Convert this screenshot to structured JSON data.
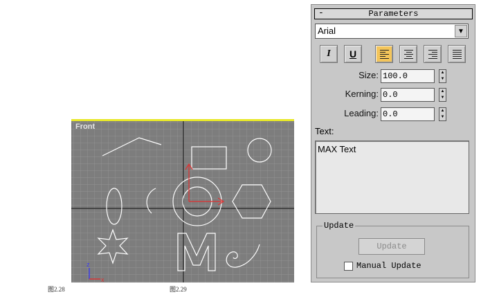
{
  "viewport": {
    "label": "Front",
    "axis_x": "x",
    "axis_z": "z"
  },
  "captions": {
    "left": "图2.28",
    "right": "图2.29"
  },
  "panel": {
    "header_symbol": "-",
    "title": "Parameters",
    "font": {
      "value": "Arial",
      "arrow": "▼"
    },
    "style_buttons": {
      "italic": "I",
      "underline": "U"
    },
    "size": {
      "label": "Size:",
      "value": "100.0"
    },
    "kerning": {
      "label": "Kerning:",
      "value": "0.0"
    },
    "leading": {
      "label": "Leading:",
      "value": "0.0"
    },
    "spinner_up": "▲",
    "spinner_down": "▼",
    "text": {
      "label": "Text:",
      "value": "MAX Text"
    },
    "update": {
      "group_label": "Update",
      "button": "Update",
      "manual_label": "Manual Update"
    }
  },
  "colors": {
    "viewport_bg": "#7d7d7d",
    "viewport_border": "#e8e82a",
    "panel_bg": "#c8c8c8",
    "active_button": "#f4c55a",
    "shape_stroke": "#ffffff",
    "axis_red": "#e03030"
  }
}
